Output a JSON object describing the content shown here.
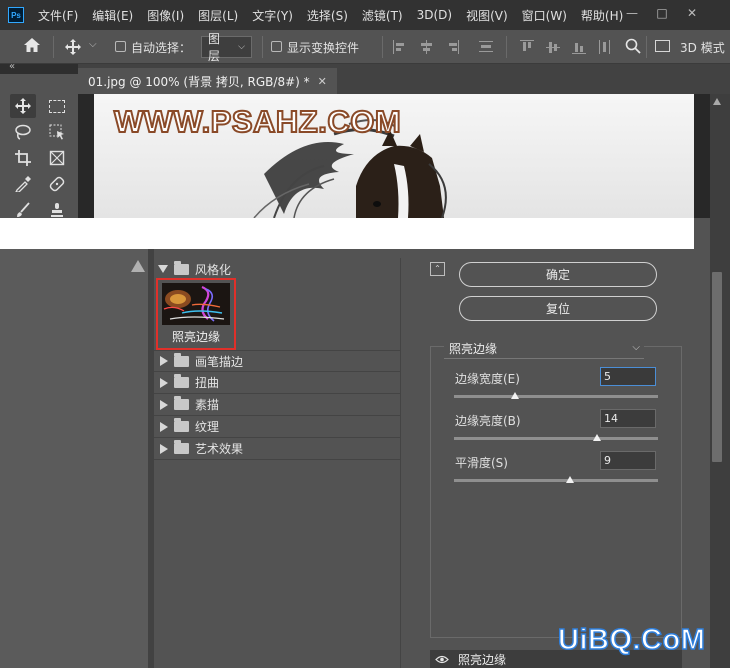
{
  "menubar": {
    "logo": "Ps",
    "items": [
      "文件(F)",
      "编辑(E)",
      "图像(I)",
      "图层(L)",
      "文字(Y)",
      "选择(S)",
      "滤镜(T)",
      "3D(D)",
      "视图(V)",
      "窗口(W)",
      "帮助(H)"
    ]
  },
  "options": {
    "auto_select_label": "自动选择：",
    "layer_select_value": "图层",
    "show_transform_label": "显示变换控件",
    "mode_3d_label": "3D 模式"
  },
  "document": {
    "tab_title": "01.jpg @ 100% (背景 拷贝, RGB/8#) *",
    "watermark": "WWW.PSAHZ.COM"
  },
  "filter_gallery": {
    "category_open": "风格化",
    "selected_filter": "照亮边缘",
    "categories": [
      "画笔描边",
      "扭曲",
      "素描",
      "纹理",
      "艺术效果"
    ],
    "ok_label": "确定",
    "reset_label": "复位",
    "filter_dropdown_value": "照亮边缘",
    "params": [
      {
        "label": "边缘宽度(E)",
        "value": "5",
        "slider": 0.3
      },
      {
        "label": "边缘亮度(B)",
        "value": "14",
        "slider": 0.7
      },
      {
        "label": "平滑度(S)",
        "value": "9",
        "slider": 0.57
      }
    ],
    "layer_row_label": "照亮边缘"
  },
  "site_watermark": "UiBQ.CoM"
}
